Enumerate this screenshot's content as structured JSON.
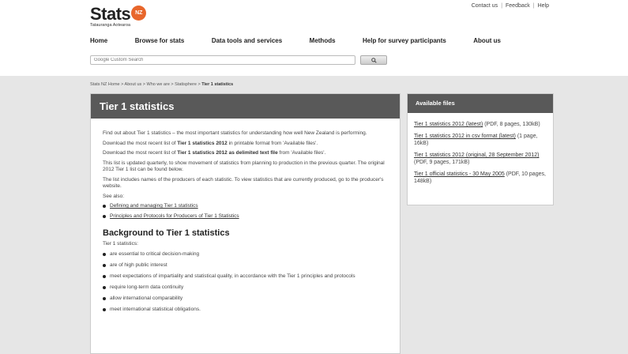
{
  "logo": {
    "word": "Stats",
    "badge": "NZ",
    "tagline": "Tatauranga Aotearoa"
  },
  "toplinks": [
    "Contact us",
    "Feedback",
    "Help"
  ],
  "nav": [
    "Home",
    "Browse for stats",
    "Data tools and services",
    "Methods",
    "Help for survey participants",
    "About us"
  ],
  "search": {
    "placeholder": "Google Custom Search",
    "button_icon": "search-icon"
  },
  "breadcrumb": {
    "path": "Stats NZ Home > About us > Who we are > Statisphere > ",
    "current": "Tier 1 statistics"
  },
  "page": {
    "title": "Tier 1 statistics",
    "intro": "Find out about Tier 1 statistics – the most important statistics for understanding how well New Zealand is performing.",
    "p1_pre": "Download the most recent list of ",
    "p1_bold": "Tier 1 statistics 2012",
    "p1_post": " in printable format from 'Available files'.",
    "p2_pre": "Download the most recent list of ",
    "p2_bold": "Tier 1 statistics 2012 as delimited text file",
    "p2_post": " from 'Available files'.",
    "p3": "This list is updated quarterly, to show movement of statistics from planning to production in the previous quarter. The original 2012 Tier 1 list can be found below.",
    "p4": "The list includes names of the producers of each statistic. To view statistics that are currently produced, go to the producer's website.",
    "see_also": "See also:",
    "see_also_links": [
      "Defining and managing Tier 1 statistics",
      "Principles and Protocols for Producers of Tier 1 Statistics"
    ],
    "heading2": "Background to Tier 1 statistics",
    "bg_intro": "Tier 1 statistics:",
    "bg_items": [
      "are essential to critical decision-making",
      "are of high public interest",
      "meet expectations of impartiality and statistical quality, in accordance with the Tier 1 principles and protocols",
      "require long-term data continuity",
      "allow international comparability",
      "meet international statistical obligations."
    ]
  },
  "side": {
    "title": "Available files",
    "files": [
      {
        "link": "Tier 1 statistics 2012 (latest)",
        "meta": " (PDF, 8 pages, 130kB)"
      },
      {
        "link": "Tier 1 statistics 2012 in csv format (latest)",
        "meta": " (1 page, 16kB)"
      },
      {
        "link": "Tier 1 statistics 2012 (original, 28 September 2012)",
        "meta": " (PDF, 9 pages, 171kB)"
      },
      {
        "link": "Tier 1 official statistics - 30 May 2005",
        "meta": " (PDF, 10 pages, 148kB)"
      }
    ]
  }
}
